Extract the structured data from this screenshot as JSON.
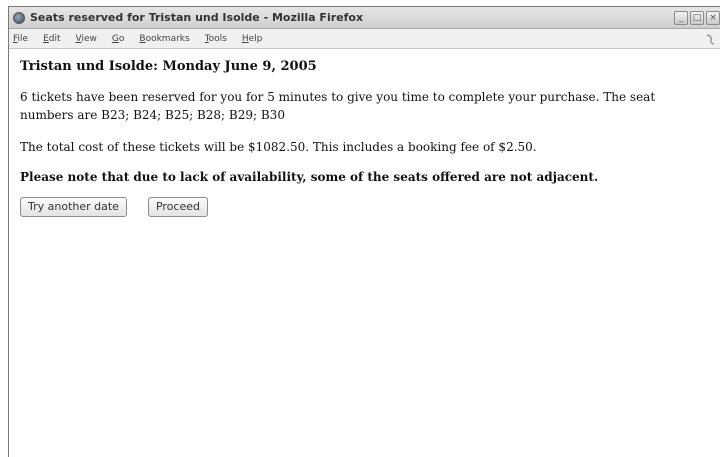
{
  "window": {
    "title": "Seats reserved for Tristan und Isolde - Mozilla Firefox",
    "controls": [
      "_",
      "□",
      "×"
    ]
  },
  "menubar": {
    "items": [
      "File",
      "Edit",
      "View",
      "Go",
      "Bookmarks",
      "Tools",
      "Help"
    ]
  },
  "page": {
    "heading": "Tristan und Isolde: Monday June 9, 2005",
    "reservation_text": "6 tickets have been reserved for you for 5 minutes to give you time to complete your purchase. The seat numbers are B23; B24; B25; B28; B29; B30",
    "cost_text": "The total cost of these tickets will be $1082.50. This includes a booking fee of $2.50.",
    "notice_text": "Please note that due to lack of availability, some of the seats offered are not adjacent.",
    "buttons": {
      "try_another": "Try another date",
      "proceed": "Proceed"
    }
  }
}
